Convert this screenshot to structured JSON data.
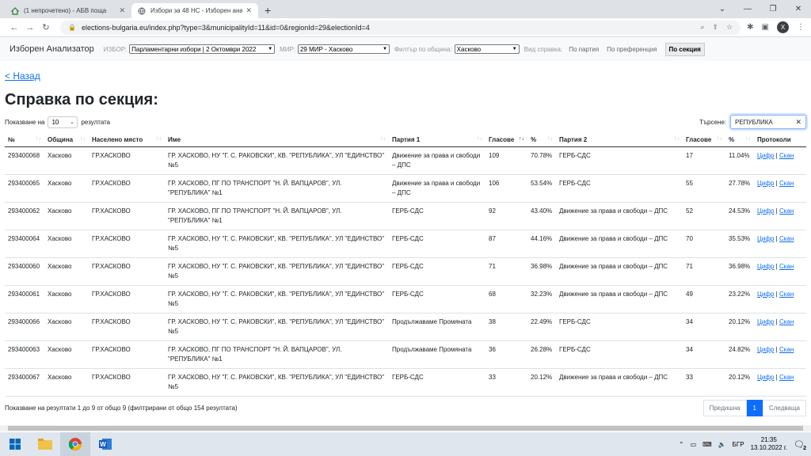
{
  "browser": {
    "tabs": [
      {
        "title": "(1 непрочетено) - АБВ поща"
      },
      {
        "title": "Избори за 48 НС - Изборен анал"
      }
    ],
    "url": "elections-bulgaria.eu/index.php?type=3&municipalityId=11&id=0&regionId=29&electionId=4",
    "profile_initial": "X"
  },
  "nav": {
    "brand": "Изборен Анализатор",
    "election_label": "ИЗБОР:",
    "election_value": "Парламентарни избори | 2 Октомври 2022",
    "mir_label": "МИР:",
    "mir_value": "29 МИР - Хасково",
    "filter_label": "Филтър по община:",
    "filter_value": "Хасково",
    "type_label": "Вид справка:",
    "link_party": "По партия",
    "link_pref": "По преференция",
    "link_section": "По секция"
  },
  "page": {
    "back": "< Назад",
    "title": "Справка по секция:",
    "show_prefix": "Показване на",
    "page_size": "10",
    "show_suffix": "резултата",
    "search_label": "Търсене:",
    "search_value": "РЕПУБЛИКА",
    "info": "Показване на резултати 1 до 9 от общо 9 (филтрирани от общо 154 резултата)",
    "prev": "Предишна",
    "current_page": "1",
    "next": "Следваща"
  },
  "table": {
    "headers": [
      "№",
      "Община",
      "Населено място",
      "Име",
      "Партия 1",
      "Гласове",
      "%",
      "Партия 2",
      "Гласове",
      "%",
      "Протоколи"
    ],
    "link_digital": "Цифр",
    "link_scan": "Скан",
    "rows": [
      {
        "id": "293400068",
        "obshtina": "Хасково",
        "place": "ГР.ХАСКОВО",
        "name": "ГР. ХАСКОВО, НУ \"Г. С. РАКОВСКИ\", КВ. \"РЕПУБЛИКА\", УЛ \"ЕДИНСТВО\" №5",
        "p1": "Движение за права и свободи – ДПС",
        "v1": "109",
        "pc1": "70.78%",
        "p2": "ГЕРБ-СДС",
        "v2": "17",
        "pc2": "11.04%"
      },
      {
        "id": "293400065",
        "obshtina": "Хасково",
        "place": "ГР.ХАСКОВО",
        "name": "ГР. ХАСКОВО, ПГ ПО ТРАНСПОРТ \"Н. Й. ВАПЦАРОВ\", УЛ. \"РЕПУБЛИКА\" №1",
        "p1": "Движение за права и свободи – ДПС",
        "v1": "106",
        "pc1": "53.54%",
        "p2": "ГЕРБ-СДС",
        "v2": "55",
        "pc2": "27.78%"
      },
      {
        "id": "293400062",
        "obshtina": "Хасково",
        "place": "ГР.ХАСКОВО",
        "name": "ГР. ХАСКОВО, ПГ ПО ТРАНСПОРТ \"Н. Й. ВАПЦАРОВ\", УЛ. \"РЕПУБЛИКА\" №1",
        "p1": "ГЕРБ-СДС",
        "v1": "92",
        "pc1": "43.40%",
        "p2": "Движение за права и свободи – ДПС",
        "v2": "52",
        "pc2": "24.53%"
      },
      {
        "id": "293400064",
        "obshtina": "Хасково",
        "place": "ГР.ХАСКОВО",
        "name": "ГР. ХАСКОВО, НУ \"Г. С. РАКОВСКИ\", КВ. \"РЕПУБЛИКА\", УЛ \"ЕДИНСТВО\" №5",
        "p1": "ГЕРБ-СДС",
        "v1": "87",
        "pc1": "44.16%",
        "p2": "Движение за права и свободи – ДПС",
        "v2": "70",
        "pc2": "35.53%"
      },
      {
        "id": "293400060",
        "obshtina": "Хасково",
        "place": "ГР.ХАСКОВО",
        "name": "ГР. ХАСКОВО, НУ \"Г. С. РАКОВСКИ\", КВ. \"РЕПУБЛИКА\", УЛ \"ЕДИНСТВО\" №5",
        "p1": "ГЕРБ-СДС",
        "v1": "71",
        "pc1": "36.98%",
        "p2": "Движение за права и свободи – ДПС",
        "v2": "71",
        "pc2": "36.98%"
      },
      {
        "id": "293400061",
        "obshtina": "Хасково",
        "place": "ГР.ХАСКОВО",
        "name": "ГР. ХАСКОВО, НУ \"Г. С. РАКОВСКИ\", КВ. \"РЕПУБЛИКА\", УЛ \"ЕДИНСТВО\" №5",
        "p1": "ГЕРБ-СДС",
        "v1": "68",
        "pc1": "32.23%",
        "p2": "Движение за права и свободи – ДПС",
        "v2": "49",
        "pc2": "23.22%"
      },
      {
        "id": "293400066",
        "obshtina": "Хасково",
        "place": "ГР.ХАСКОВО",
        "name": "ГР. ХАСКОВО, НУ \"Г. С. РАКОВСКИ\", КВ. \"РЕПУБЛИКА\", УЛ \"ЕДИНСТВО\" №5",
        "p1": "Продължаваме Промяната",
        "v1": "38",
        "pc1": "22.49%",
        "p2": "ГЕРБ-СДС",
        "v2": "34",
        "pc2": "20.12%"
      },
      {
        "id": "293400063",
        "obshtina": "Хасково",
        "place": "ГР.ХАСКОВО",
        "name": "ГР. ХАСКОВО, ПГ ПО ТРАНСПОРТ \"Н. Й. ВАПЦАРОВ\", УЛ. \"РЕПУБЛИКА\" №1",
        "p1": "Продължаваме Промяната",
        "v1": "36",
        "pc1": "26.28%",
        "p2": "ГЕРБ-СДС",
        "v2": "34",
        "pc2": "24.82%"
      },
      {
        "id": "293400067",
        "obshtina": "Хасково",
        "place": "ГР.ХАСКОВО",
        "name": "ГР. ХАСКОВО, НУ \"Г. С. РАКОВСКИ\", КВ. \"РЕПУБЛИКА\", УЛ \"ЕДИНСТВО\" №5",
        "p1": "ГЕРБ-СДС",
        "v1": "33",
        "pc1": "20.12%",
        "p2": "Движение за права и свободи – ДПС",
        "v2": "33",
        "pc2": "20.12%"
      }
    ]
  },
  "taskbar": {
    "lang": "БГР",
    "time": "21:35",
    "date": "13.10.2022 г.",
    "notif_count": "2"
  },
  "colors": {
    "link": "#0d6efd",
    "navbar_bg": "#f8f9fa",
    "taskbar_bg": "#dfe6ee"
  }
}
